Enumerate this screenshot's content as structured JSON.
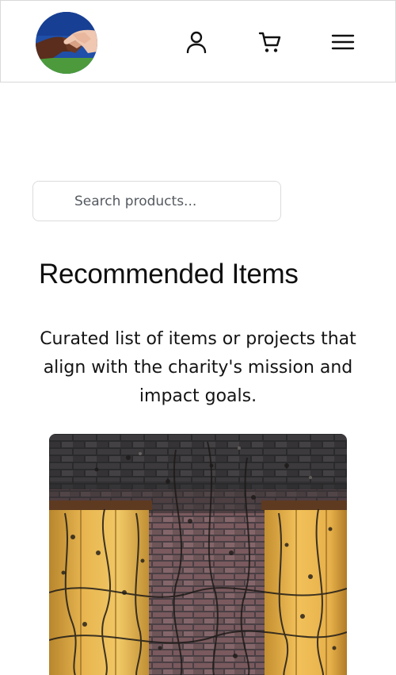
{
  "header": {
    "logo_icon": "handshake-logo",
    "user_icon": "user-icon",
    "cart_icon": "cart-icon",
    "menu_icon": "hamburger-menu-icon"
  },
  "search": {
    "placeholder": "Search products..."
  },
  "main": {
    "title": "Recommended Items",
    "description": "Curated list of items or projects that align with the charity's mission and impact goals."
  },
  "colors": {
    "logo_sky": "#1f4fa8",
    "logo_grass": "#4c9a3c",
    "text": "#111111",
    "border": "#dcdcdc"
  }
}
